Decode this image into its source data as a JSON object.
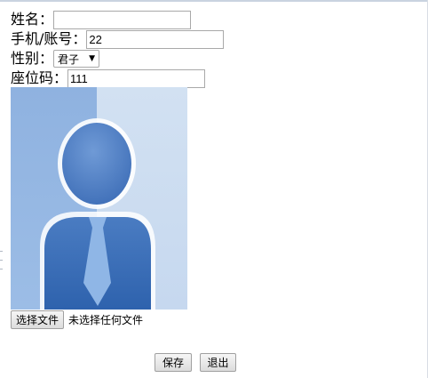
{
  "form": {
    "name": {
      "label": "姓名：",
      "value": ""
    },
    "phone": {
      "label": "手机/账号：",
      "value": "22"
    },
    "gender": {
      "label": "性别：",
      "selected": "君子"
    },
    "seat": {
      "label": "座位码：",
      "value": "111"
    }
  },
  "photo": {
    "icon": "user-avatar-placeholder"
  },
  "file": {
    "button_label": "选择文件",
    "status": "未选择任何文件"
  },
  "actions": {
    "save_label": "保存",
    "exit_label": "退出"
  }
}
